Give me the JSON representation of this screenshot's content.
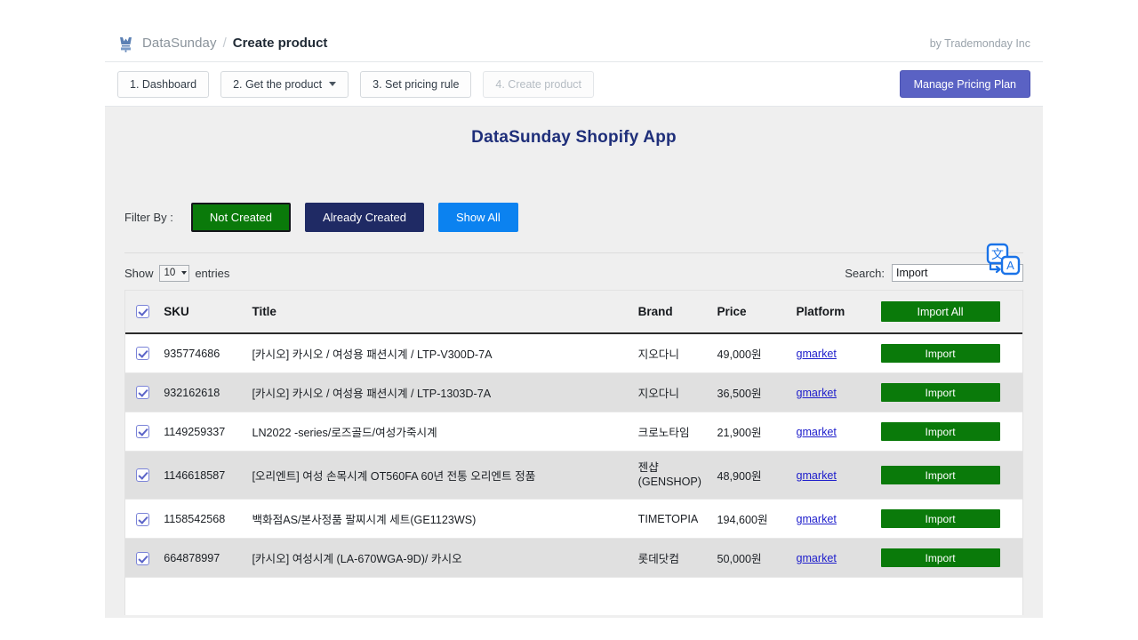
{
  "header": {
    "logo_icon": "datasunday-logo-icon",
    "brand": "DataSunday",
    "separator": "/",
    "current_page": "Create product",
    "byline": "by Trademonday Inc"
  },
  "steps": [
    {
      "label": "1. Dashboard",
      "disabled": false,
      "caret": false
    },
    {
      "label": "2. Get the product",
      "disabled": false,
      "caret": true
    },
    {
      "label": "3. Set pricing rule",
      "disabled": false,
      "caret": false
    },
    {
      "label": "4. Create product",
      "disabled": true,
      "caret": false
    }
  ],
  "plan_button": "Manage Pricing Plan",
  "main": {
    "app_title": "DataSunday Shopify App",
    "translate_icon": "translate-icon",
    "filter_label": "Filter By :",
    "filters": [
      {
        "label": "Not Created",
        "color": "#0a7a0a",
        "active": true
      },
      {
        "label": "Already Created",
        "color": "#1f2a64",
        "active": false
      },
      {
        "label": "Show All",
        "color": "#0b82f0",
        "active": false
      }
    ]
  },
  "controls": {
    "show_prefix": "Show",
    "entries_value": "10",
    "show_suffix": "entries",
    "search_label": "Search:",
    "search_value": "Import",
    "search_placeholder": ""
  },
  "table": {
    "columns": [
      "SKU",
      "Title",
      "Brand",
      "Price",
      "Platform"
    ],
    "import_all_label": "Import All",
    "import_label": "Import",
    "platform_value": "gmarket",
    "rows": [
      {
        "checked": true,
        "sku": "935774686",
        "title": "[카시오] 카시오 / 여성용 패션시계 / LTP-V300D-7A",
        "brand": "지오다니",
        "price": "49,000원",
        "platform": "gmarket",
        "action": "Import"
      },
      {
        "checked": true,
        "sku": "932162618",
        "title": "[카시오] 카시오 / 여성용 패션시계 / LTP-1303D-7A",
        "brand": "지오다니",
        "price": "36,500원",
        "platform": "gmarket",
        "action": "Import"
      },
      {
        "checked": true,
        "sku": "1149259337",
        "title": "LN2022 -series/로즈골드/여성가죽시계",
        "brand": "크로노타임",
        "price": "21,900원",
        "platform": "gmarket",
        "action": "Import"
      },
      {
        "checked": true,
        "sku": "1146618587",
        "title": "[오리엔트] 여성 손목시계 OT560FA 60년 전통 오리엔트 정품",
        "brand": "젠샵 (GENSHOP)",
        "price": "48,900원",
        "platform": "gmarket",
        "action": "Import"
      },
      {
        "checked": true,
        "sku": "1158542568",
        "title": "백화점AS/본사정품 팔찌시계 세트(GE1123WS)",
        "brand": "TIMETOPIA",
        "price": "194,600원",
        "platform": "gmarket",
        "action": "Import"
      },
      {
        "checked": true,
        "sku": "664878997",
        "title": "[카시오] 여성시계 (LA-670WGA-9D)/ 카시오",
        "brand": "롯데닷컴",
        "price": "50,000원",
        "platform": "gmarket",
        "action": "Import"
      }
    ]
  }
}
